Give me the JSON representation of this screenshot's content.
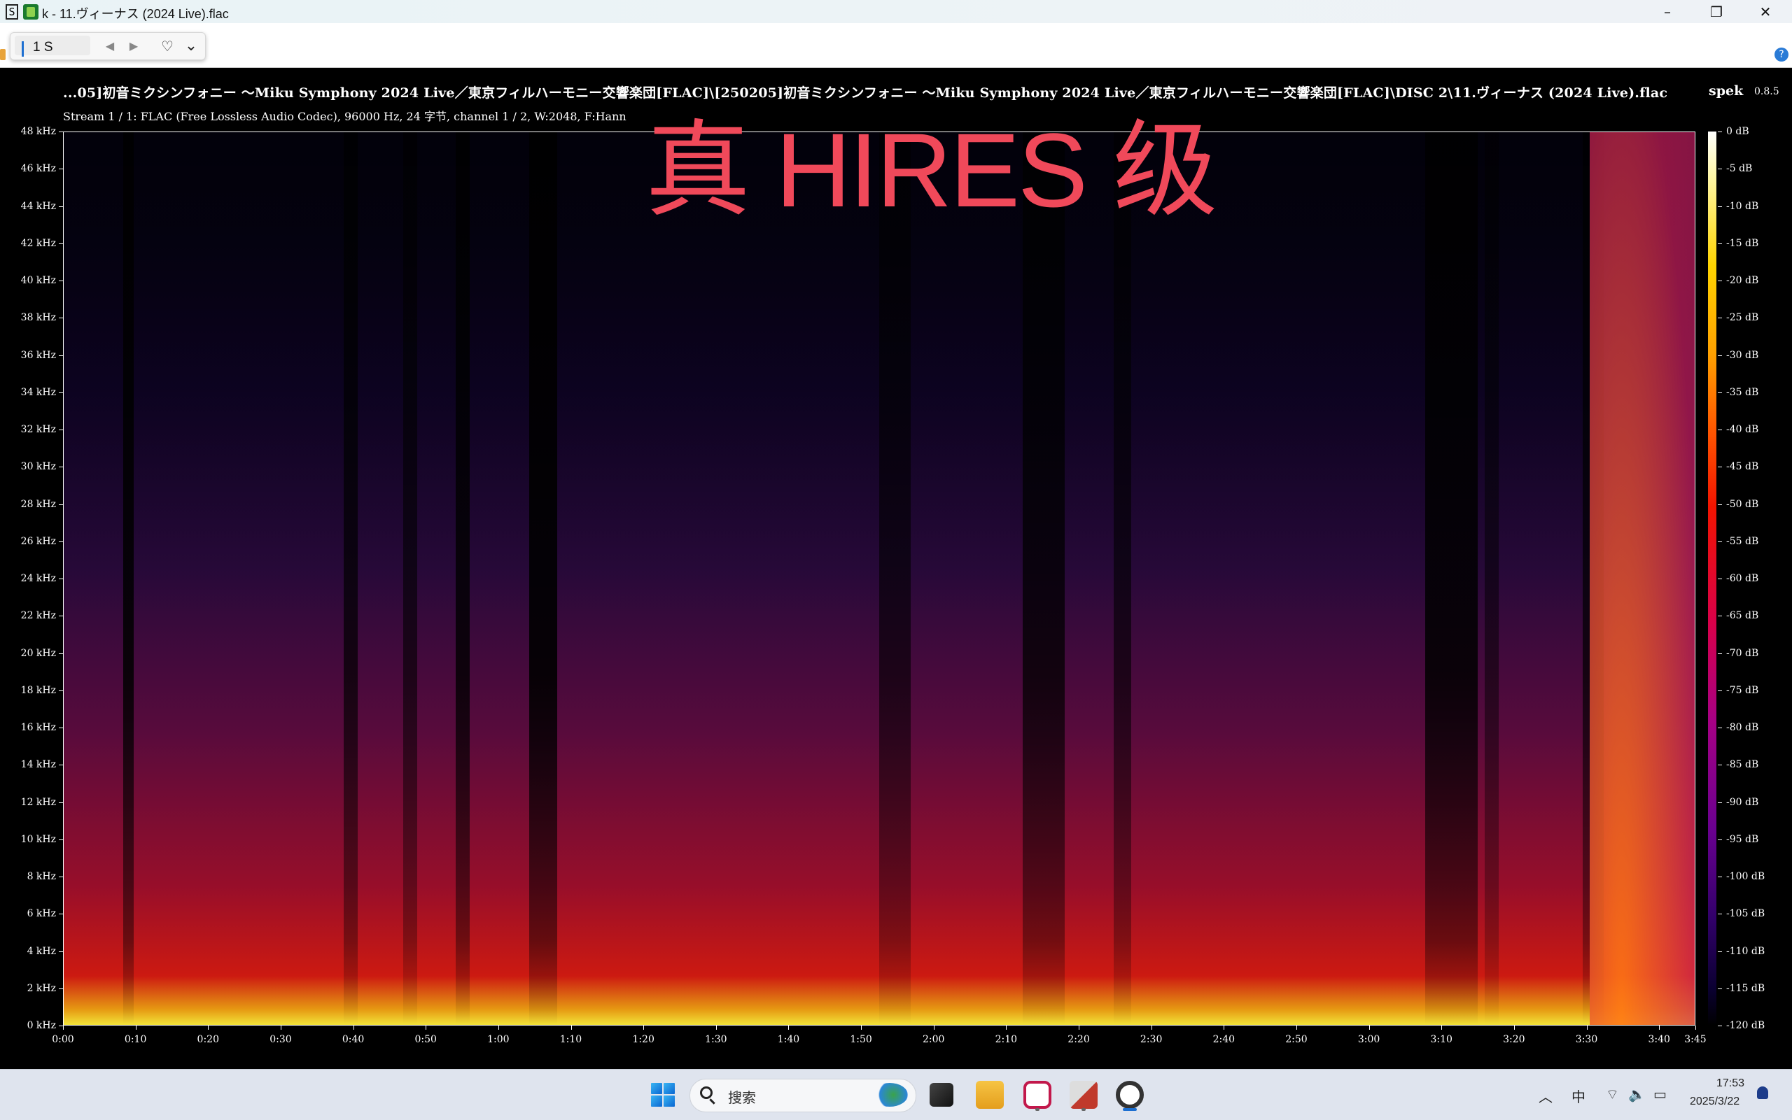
{
  "window": {
    "title": "k - 11.ヴィーナス (2024 Live).flac",
    "minimize": "–",
    "maximize": "❐",
    "close": "✕",
    "sys_menu": "S"
  },
  "popup": {
    "field_text": "1 S",
    "prev": "◀",
    "next": "▶",
    "fav": "♡",
    "more": "⌄"
  },
  "help_label": "?",
  "spek": {
    "path": "...05]初音ミクシンフォニー ～Miku Symphony 2024 Live／東京フィルハーモニー交響楽団[FLAC]\\[250205]初音ミクシンフォニー ～Miku Symphony 2024 Live／東京フィルハーモニー交響楽団[FLAC]\\DISC 2\\11.ヴィーナス (2024 Live).flac",
    "stream": "Stream 1 / 1: FLAC (Free Lossless Audio Codec), 96000 Hz, 24 字节, channel 1 / 2, W:2048, F:Hann",
    "app_name": "spek",
    "version": "0.8.5"
  },
  "overlay_text": "真 HIRES 级",
  "chart_data": {
    "type": "heatmap",
    "title": "",
    "xlabel": "",
    "ylabel": "",
    "y_ticks": [
      "0 kHz",
      "2 kHz",
      "4 kHz",
      "6 kHz",
      "8 kHz",
      "10 kHz",
      "12 kHz",
      "14 kHz",
      "16 kHz",
      "18 kHz",
      "20 kHz",
      "22 kHz",
      "24 kHz",
      "26 kHz",
      "28 kHz",
      "30 kHz",
      "32 kHz",
      "34 kHz",
      "36 kHz",
      "38 kHz",
      "40 kHz",
      "42 kHz",
      "44 kHz",
      "46 kHz",
      "48 kHz"
    ],
    "y_range_khz": [
      0,
      48
    ],
    "x_ticks": [
      "0:00",
      "0:10",
      "0:20",
      "0:30",
      "0:40",
      "0:50",
      "1:00",
      "1:10",
      "1:20",
      "1:30",
      "1:40",
      "1:50",
      "2:00",
      "2:10",
      "2:20",
      "2:30",
      "2:40",
      "2:50",
      "3:00",
      "3:10",
      "3:20",
      "3:30",
      "3:40",
      "3:45"
    ],
    "x_range_seconds": [
      0,
      225
    ],
    "db_ticks": [
      "0 dB",
      "-5 dB",
      "-10 dB",
      "-15 dB",
      "-20 dB",
      "-25 dB",
      "-30 dB",
      "-35 dB",
      "-40 dB",
      "-45 dB",
      "-50 dB",
      "-55 dB",
      "-60 dB",
      "-65 dB",
      "-70 dB",
      "-75 dB",
      "-80 dB",
      "-85 dB",
      "-90 dB",
      "-95 dB",
      "-100 dB",
      "-105 dB",
      "-110 dB",
      "-115 dB",
      "-120 dB"
    ],
    "db_range": [
      -120,
      0
    ],
    "colormap": [
      "#ffffff",
      "#ffd400",
      "#ff5a00",
      "#f21400",
      "#d8004a",
      "#a60085",
      "#6a0090",
      "#32006a",
      "#000000"
    ]
  },
  "taskbar": {
    "search_placeholder": "搜索",
    "ime": "中",
    "time": "17:53",
    "date": "2025/3/22",
    "tray_up": "︿",
    "wifi": "⌔",
    "volume": "🔈",
    "battery": "▭"
  }
}
